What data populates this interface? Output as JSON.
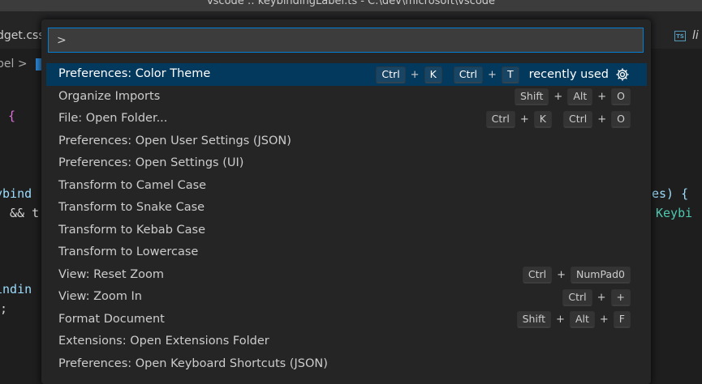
{
  "window": {
    "title": "vscode :: keybindingLabel.ts - C:\\dev\\microsoft\\vscode"
  },
  "tabs": {
    "left_label": "dget.css",
    "right_icon_text": "TS",
    "right_label": "li"
  },
  "breadcrumb": {
    "text": "bel >"
  },
  "editor": {
    "lines": [
      {
        "text": "{"
      },
      {
        "text": "ybind"
      },
      {
        "text": "&& t"
      },
      {
        "text": "es) {"
      },
      {
        "text": "Keybi"
      },
      {
        "text": "indin"
      },
      {
        "text": ";"
      }
    ]
  },
  "quickpick": {
    "input_value": ">",
    "items": [
      {
        "label": "Preferences: Color Theme",
        "chords": [
          [
            "Ctrl",
            "K"
          ],
          [
            "Ctrl",
            "T"
          ]
        ],
        "description": "recently used",
        "selected": true
      },
      {
        "label": "Organize Imports",
        "chords": [
          [
            "Shift",
            "Alt",
            "O"
          ]
        ]
      },
      {
        "label": "File: Open Folder...",
        "chords": [
          [
            "Ctrl",
            "K"
          ],
          [
            "Ctrl",
            "O"
          ]
        ]
      },
      {
        "label": "Preferences: Open User Settings (JSON)",
        "chords": []
      },
      {
        "label": "Preferences: Open Settings (UI)",
        "chords": []
      },
      {
        "label": "Transform to Camel Case",
        "chords": []
      },
      {
        "label": "Transform to Snake Case",
        "chords": []
      },
      {
        "label": "Transform to Kebab Case",
        "chords": []
      },
      {
        "label": "Transform to Lowercase",
        "chords": []
      },
      {
        "label": "View: Reset Zoom",
        "chords": [
          [
            "Ctrl",
            "NumPad0"
          ]
        ]
      },
      {
        "label": "View: Zoom In",
        "chords": [
          [
            "Ctrl",
            "+"
          ]
        ]
      },
      {
        "label": "Format Document",
        "chords": [
          [
            "Shift",
            "Alt",
            "F"
          ]
        ]
      },
      {
        "label": "Extensions: Open Extensions Folder",
        "chords": []
      },
      {
        "label": "Preferences: Open Keyboard Shortcuts (JSON)",
        "chords": []
      }
    ],
    "plus_symbol": "+",
    "gear_icon": "gear-icon"
  },
  "colors": {
    "selection_bg": "#04395e",
    "focus_border": "#007fd4",
    "widget_bg": "#252526"
  }
}
